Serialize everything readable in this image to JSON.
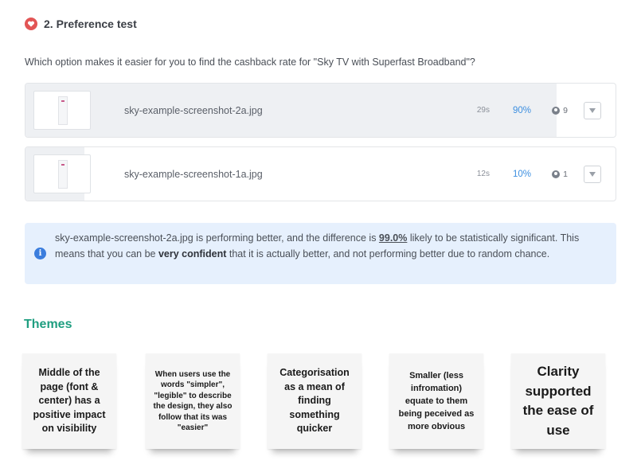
{
  "section": {
    "icon": "heart-icon",
    "title": "2. Preference test"
  },
  "question": "Which option makes it easier for you to find the cashback rate for \"Sky TV with Superfast Broadband\"?",
  "options": [
    {
      "filename": "sky-example-screenshot-2a.jpg",
      "time": "29s",
      "percent": "90%",
      "count": "9",
      "share": 0.9
    },
    {
      "filename": "sky-example-screenshot-1a.jpg",
      "time": "12s",
      "percent": "10%",
      "count": "1",
      "share": 0.1
    }
  ],
  "info": {
    "icon": "info-icon",
    "part1": "sky-example-screenshot-2a.jpg is performing better, and the difference is ",
    "percent": "99.0%",
    "part2": " likely to be statistically significant. This means that you can be ",
    "emphasis": "very confident",
    "part3": " that it is actually better, and not performing better due to random chance."
  },
  "themes": {
    "title": "Themes",
    "notes": [
      "Middle of the page (font & center) has a positive impact on visibility",
      "When users use the words \"simpler\", \"legible\" to describe the design, they also follow that its was \"easier\"",
      "Categorisation as a mean of finding something quicker",
      "Smaller (less infromation) equate to them being peceived as more obvious",
      "Clarity supported the ease of use"
    ]
  },
  "colors": {
    "accent": "#3d8fe0",
    "themes": "#1f9e80",
    "heart": "#e25555",
    "info_bg": "#e6f0fd"
  }
}
